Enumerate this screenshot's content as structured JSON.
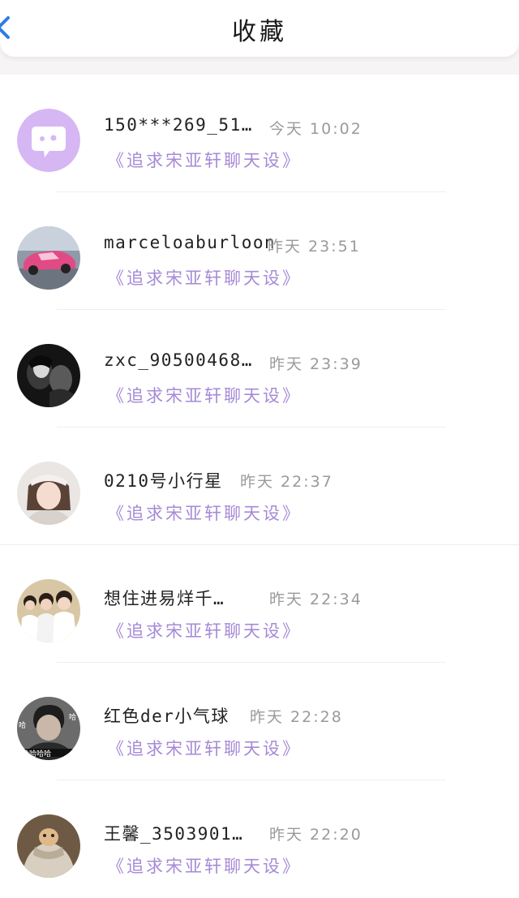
{
  "header": {
    "title": "收藏"
  },
  "colors": {
    "accent_purple": "#a68ad6",
    "avatar_bubble": "#d6b7f4"
  },
  "items": [
    {
      "name": "150***269_51…",
      "time": "今天 10:02",
      "subtitle": "《追求宋亚轩聊天设》",
      "avatar": "chat-bubble-avatar"
    },
    {
      "name": "marceloaburloon",
      "time": "昨天 23:51",
      "subtitle": "《追求宋亚轩聊天设》",
      "avatar": "pink-car-avatar"
    },
    {
      "name": "zxc_90500468…",
      "time": "昨天 23:39",
      "subtitle": "《追求宋亚轩聊天设》",
      "avatar": "dark-couple-avatar"
    },
    {
      "name": "0210号小行星",
      "time": "昨天 22:37",
      "subtitle": "《追求宋亚轩聊天设》",
      "avatar": "girl-avatar"
    },
    {
      "name": "想住进易烊千…",
      "time": "昨天 22:34",
      "subtitle": "《追求宋亚轩聊天设》",
      "avatar": "group-photo-avatar"
    },
    {
      "name": "红色der小气球",
      "time": "昨天 22:28",
      "subtitle": "《追求宋亚轩聊天设》",
      "avatar": "laughing-man-avatar"
    },
    {
      "name": "王馨_3503901…",
      "time": "昨天 22:20",
      "subtitle": "《追求宋亚轩聊天设》",
      "avatar": "wrapped-pet-avatar"
    }
  ]
}
